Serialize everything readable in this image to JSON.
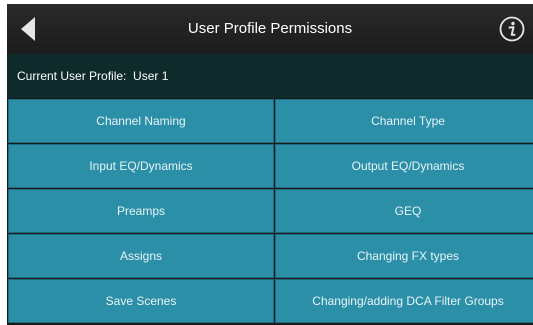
{
  "header": {
    "title": "User Profile Permissions",
    "back_icon": "back-arrow-icon",
    "info_icon": "info-icon"
  },
  "profile": {
    "label": "Current User Profile:",
    "value": "User 1"
  },
  "permissions": [
    [
      "Channel Naming",
      "Channel Type"
    ],
    [
      "Input EQ/Dynamics",
      "Output EQ/Dynamics"
    ],
    [
      "Preamps",
      "GEQ"
    ],
    [
      "Assigns",
      "Changing FX types"
    ],
    [
      "Save Scenes",
      "Changing/adding DCA Filter Groups"
    ]
  ],
  "colors": {
    "header": "#1c1c1c",
    "profile_bar": "#0f2a2a",
    "cell": "#2b8fa8",
    "cell_border": "#1e6b80"
  }
}
